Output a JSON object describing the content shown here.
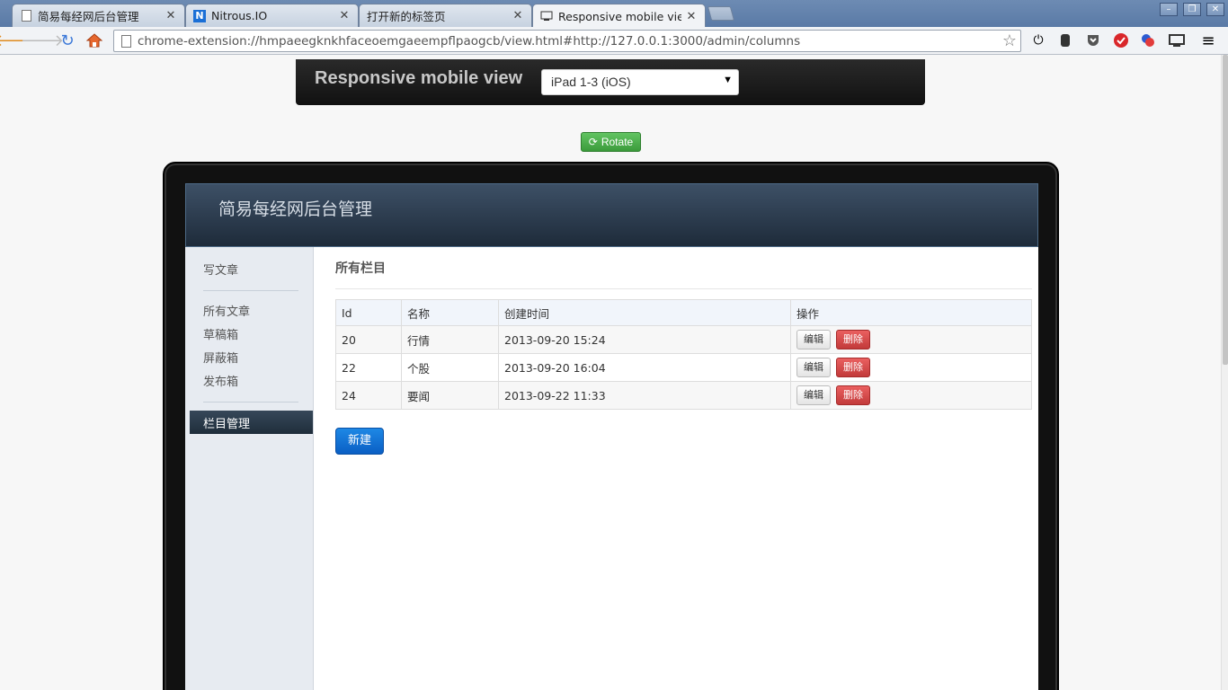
{
  "browser": {
    "tabs": [
      {
        "title": "简易每经网后台管理",
        "icon": "page-icon"
      },
      {
        "title": "Nitrous.IO",
        "icon": "nitrous-icon"
      },
      {
        "title": "打开新的标签页",
        "icon": "none"
      },
      {
        "title": "Responsive mobile view",
        "icon": "responsive-icon"
      }
    ],
    "url": "chrome-extension://hmpaeegknkhfaceoemgaeempflpaogcb/view.html#http://127.0.0.1:3000/admin/columns"
  },
  "rmv": {
    "title": "Responsive mobile view",
    "device_selected": "iPad 1-3 (iOS)",
    "rotate_label": "Rotate"
  },
  "app": {
    "title": "简易每经网后台管理",
    "sidebar": {
      "write": "写文章",
      "all_articles": "所有文章",
      "drafts": "草稿箱",
      "blocked": "屏蔽箱",
      "published": "发布箱",
      "column_mgmt": "栏目管理"
    },
    "main": {
      "title": "所有栏目",
      "headers": [
        "Id",
        "名称",
        "创建时间",
        "操作"
      ],
      "rows": [
        {
          "id": "20",
          "name": "行情",
          "created": "2013-09-20 15:24"
        },
        {
          "id": "22",
          "name": "个股",
          "created": "2013-09-20 16:04"
        },
        {
          "id": "24",
          "name": "要闻",
          "created": "2013-09-22 11:33"
        }
      ],
      "edit_label": "编辑",
      "delete_label": "删除",
      "new_label": "新建"
    }
  },
  "colors": {
    "header_dark": "#1e2b3a",
    "new_button": "#0a5fc4",
    "delete_button": "#c23a3a",
    "rotate_button": "#3b9b3b"
  }
}
